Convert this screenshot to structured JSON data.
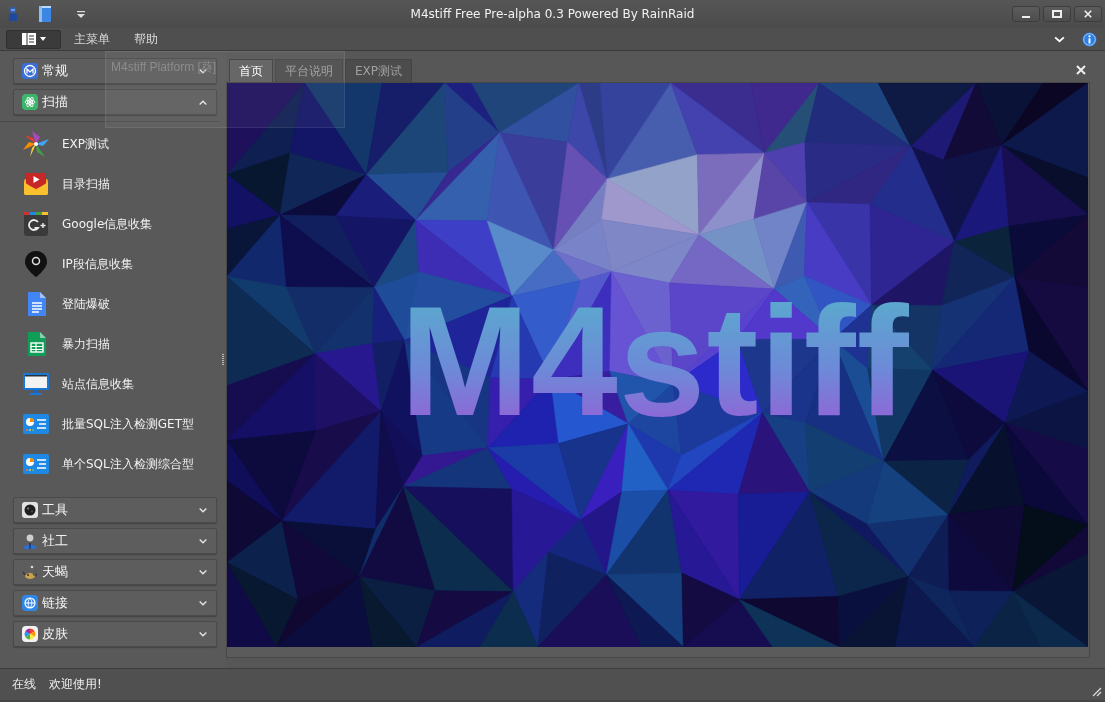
{
  "window": {
    "title": "M4stiff Free Pre-alpha 0.3 Powered By RainRaid"
  },
  "menu_bar": {
    "items": [
      "主菜单",
      "帮助"
    ]
  },
  "ghost_window": {
    "title": "M4stiff Platform [葵]"
  },
  "sidebar": {
    "sections": [
      {
        "label": "常规",
        "expanded": false
      },
      {
        "label": "扫描",
        "expanded": true,
        "items": [
          "EXP测试",
          "目录扫描",
          "Google信息收集",
          "IP段信息收集",
          "登陆爆破",
          "暴力扫描",
          "站点信息收集",
          "批量SQL注入检测GET型",
          "单个SQL注入检测综合型"
        ]
      },
      {
        "label": "工具",
        "expanded": false
      },
      {
        "label": "社工",
        "expanded": false
      },
      {
        "label": "天蝎",
        "expanded": false
      },
      {
        "label": "链接",
        "expanded": false
      },
      {
        "label": "皮肤",
        "expanded": false
      }
    ]
  },
  "tabs": [
    {
      "label": "首页",
      "selected": true
    },
    {
      "label": "平台说明",
      "selected": false
    },
    {
      "label": "EXP测试",
      "selected": false
    }
  ],
  "banner": {
    "title": "M4stiff"
  },
  "status_bar": {
    "items": [
      "在线",
      "欢迎使用!"
    ]
  }
}
